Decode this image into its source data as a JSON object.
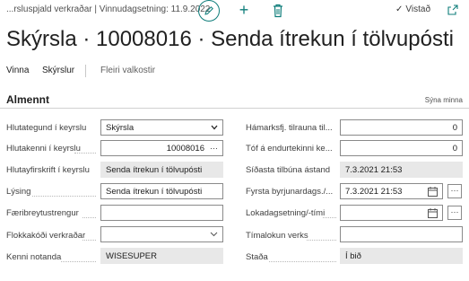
{
  "header": {
    "breadcrumb": "...rsluspjald verkraðar | Vinnudagsetning: 11.9.2022",
    "saved_label": "Vistað"
  },
  "page": {
    "title": "Skýrsla · 10008016 · Senda ítrekun í tölvupósti"
  },
  "actions": {
    "items": [
      "Vinna",
      "Skýrslur"
    ],
    "more": "Fleiri valkostir"
  },
  "section": {
    "title": "Almennt",
    "show_more": "Sýna minna"
  },
  "left_fields": [
    {
      "label": "Hlutategund í keyrslu",
      "value": "Skýrsla"
    },
    {
      "label": "Hlutakenni í keyrslu",
      "value": "10008016",
      "suffix": "···"
    },
    {
      "label": "Hlutayfirskrift í keyrslu",
      "value": "Senda ítrekun í tölvupósti"
    },
    {
      "label": "Lýsing",
      "value": "Senda ítrekun í tölvupósti"
    },
    {
      "label": "Færibreytustrengur",
      "value": ""
    },
    {
      "label": "Flokkakóði verkraðar",
      "value": ""
    },
    {
      "label": "Kenni notanda",
      "value": "WISESUPER"
    }
  ],
  "right_fields": [
    {
      "label": "Hámarksfj. tilrauna til...",
      "value": "0"
    },
    {
      "label": "Tóf á endurtekinni ke...",
      "value": "0"
    },
    {
      "label": "Síðasta tilbúna ástand",
      "value": "7.3.2021 21:53"
    },
    {
      "label": "Fyrsta byrjunardags./...",
      "value": "7.3.2021 21:53",
      "button": "···"
    },
    {
      "label": "Lokadagsetning/-tími",
      "value": "",
      "button": "···"
    },
    {
      "label": "Tímalokun verks",
      "value": ""
    },
    {
      "label": "Staða",
      "value": "Í bið"
    }
  ]
}
